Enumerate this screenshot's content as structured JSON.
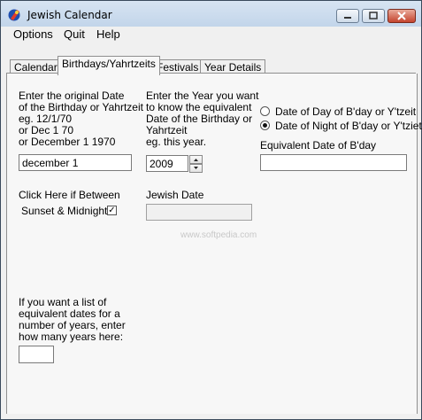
{
  "window": {
    "title": "Jewish Calendar"
  },
  "menu": [
    "Options",
    "Quit",
    "Help"
  ],
  "tabs": [
    "Calendar",
    "Birthdays/Yahrtzeits",
    "Festivals",
    "Year Details"
  ],
  "left": {
    "lines": [
      "Enter the original Date",
      "of the Birthday or Yahrtzeit",
      " eg. 12/1/70",
      " or  Dec 1 70",
      " or  December 1 1970"
    ],
    "date_value": "december 1",
    "sunset_lines": [
      "Click Here if Between",
      "Sunset & Midnight"
    ],
    "checkmark": "✓",
    "years_lines": [
      "If you want a list of",
      "equivalent dates for a",
      "number of years, enter",
      "how many years here:"
    ],
    "years_value": ""
  },
  "middle": {
    "lines": [
      "Enter the Year you want",
      " to know the equivalent",
      " Date of the Birthday or",
      " Yahrtzeit",
      " eg. this year."
    ],
    "year_value": "2009",
    "jewish_date_label": "Jewish Date",
    "jewish_date_value": ""
  },
  "right": {
    "radio_day": "Date of Day of B'day or Y'tzeit",
    "radio_night": "Date of Night of B'day or Y'tziet",
    "equiv_label": "Equivalent Date of B'day",
    "equiv_value": ""
  },
  "watermark": "www.softpedia.com"
}
